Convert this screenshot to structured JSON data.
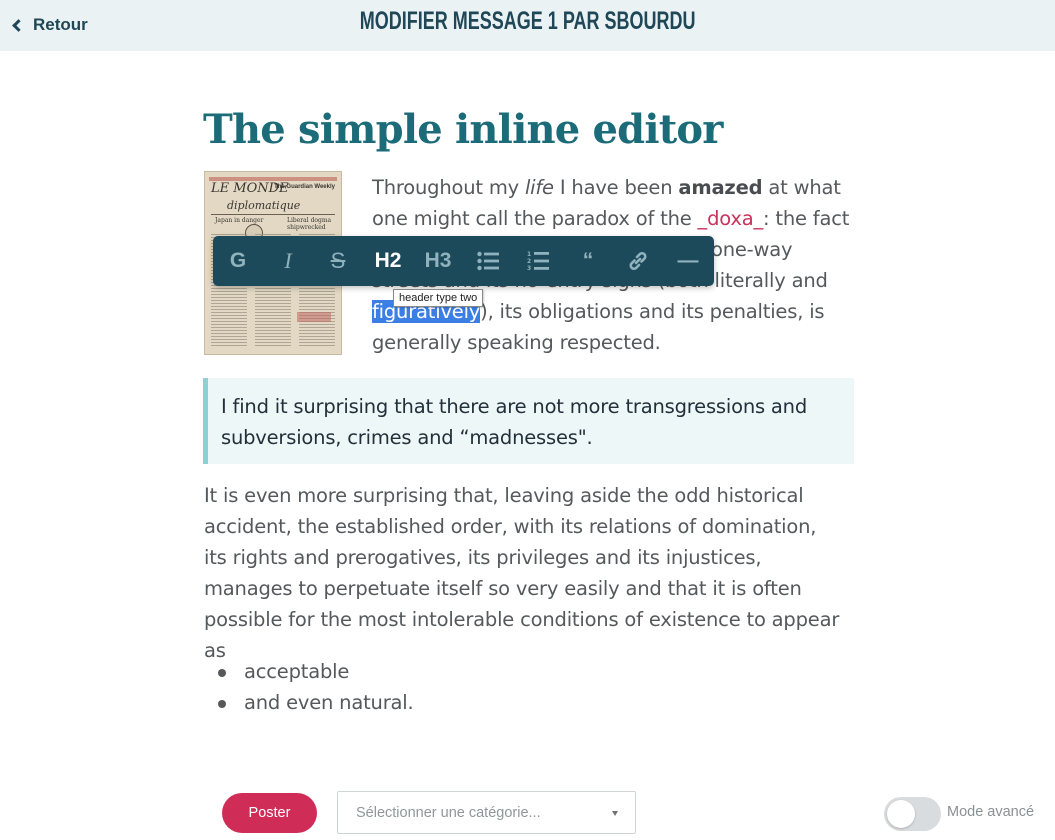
{
  "header": {
    "back_label": "Retour",
    "title": "MODIFIER MESSAGE 1 PAR SBOURDU"
  },
  "editor": {
    "title": "The simple inline editor",
    "image": {
      "masthead": "LE MONDE",
      "masthead_sub": "diplomatique",
      "guardian": "The Guardian Weekly",
      "headline_left": "Japan in danger",
      "headline_right": "Liberal dogma shipwrecked"
    },
    "para1": {
      "t1": "Throughout my ",
      "t_italic": "life",
      "t2": " I have been ",
      "t_bold": "amazed",
      "t3": " at what one might call the paradox of the ",
      "code": "_doxa_",
      "t4": ": the fact that the world is as it is, with all its one-way streets and its no-entry ",
      "strike": "signs",
      "t5": " (both literally and ",
      "selected": "figuratively",
      "t6": "), its obligations and its penalties, is generally speaking respected."
    },
    "blockquote": "I find it surprising that there are not more transgressions and subversions, crimes and “madnesses\".",
    "para2": "It is even more surprising that, leaving aside the odd historical accident, the established order, with its relations of domination, its rights and prerogatives, its privileges and its injustices, manages to perpetuate itself so very easily and that it is often possible for the most intolerable conditions of existence to appear as",
    "list": [
      "acceptable",
      "and even natural."
    ]
  },
  "toolbar": {
    "buttons": [
      {
        "name": "bold",
        "label": "G",
        "icon": "bold-icon"
      },
      {
        "name": "italic",
        "label": "I",
        "icon": "italic-icon"
      },
      {
        "name": "strikethrough",
        "label": "S",
        "icon": "strikethrough-icon"
      },
      {
        "name": "h2",
        "label": "H2",
        "icon": "h2-icon",
        "active": true
      },
      {
        "name": "h3",
        "label": "H3",
        "icon": "h3-icon"
      },
      {
        "name": "unordered-list",
        "label": "",
        "icon": "bullet-list-icon"
      },
      {
        "name": "ordered-list",
        "label": "",
        "icon": "numbered-list-icon"
      },
      {
        "name": "quote",
        "label": "“",
        "icon": "quote-icon"
      },
      {
        "name": "link",
        "label": "",
        "icon": "link-icon"
      },
      {
        "name": "horizontal-rule",
        "label": "—",
        "icon": "horizontal-rule-icon"
      }
    ],
    "tooltip": "header type two"
  },
  "footer": {
    "post_label": "Poster",
    "category_placeholder": "Sélectionner une catégorie...",
    "advanced_mode_label": "Mode avancé",
    "advanced_mode_on": false
  },
  "colors": {
    "header_bg": "#ebf2f4",
    "title": "#1b6c78",
    "toolbar_bg": "#1d4a5b",
    "post_button": "#cf2d58",
    "selection": "#3a7ee6",
    "quote_border": "#8cd2d2"
  }
}
